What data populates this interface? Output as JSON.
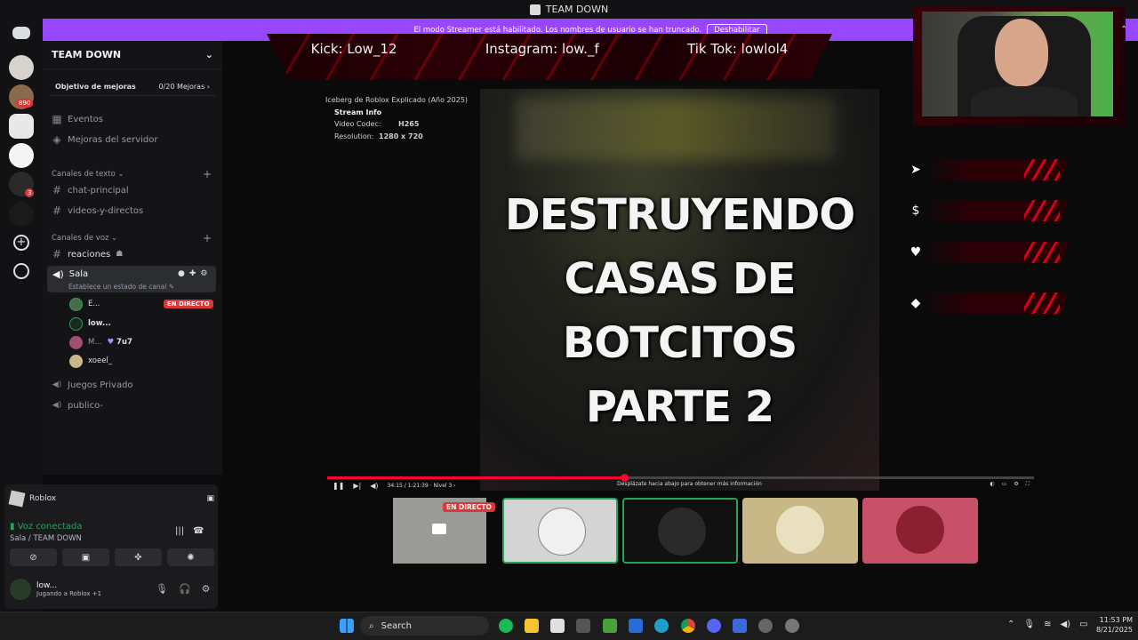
{
  "window": {
    "title": "TEAM DOWN"
  },
  "banner": {
    "text": "El modo Streamer está habilitado. Los nombres de usuario se han truncado.",
    "button": "Deshabilitar"
  },
  "rail": {
    "badges": [
      "890",
      "3"
    ]
  },
  "server": {
    "name": "TEAM DOWN",
    "boost": {
      "label": "Objetivo de mejoras",
      "progress": "0/20 Mejoras"
    },
    "events": "Eventos",
    "server_boosts": "Mejoras del servidor",
    "text_category": "Canales de texto",
    "text_channels": [
      "chat-principal",
      "videos-y-directos"
    ],
    "voice_category": "Canales de voz",
    "reactions_channel": "reaciones",
    "active_voice": {
      "name": "Sala",
      "status": "Establece un estado de canal"
    },
    "members": [
      {
        "name": "E...",
        "live": "EN DIRECTO"
      },
      {
        "name": "low..."
      },
      {
        "name": "M...",
        "tag": "7u7"
      },
      {
        "name": "xoeel_"
      }
    ],
    "other_voice": [
      "Juegos Privado",
      "publico-"
    ]
  },
  "user_panel": {
    "activity": "Roblox",
    "voice_connected": "Voz conectada",
    "voice_location": "Sala / TEAM DOWN",
    "username": "low...",
    "status": "Jugando a Roblox +1"
  },
  "stream": {
    "socials": [
      "Kick: Low_12",
      "Instagram: low._f",
      "Tik Tok: lowlol4"
    ],
    "video_title": "Iceberg de Roblox Explicado (Año 2025)",
    "info_title": "Stream Info",
    "codec_label": "Video Codec:",
    "codec_value": "H265",
    "res_label": "Resolution:",
    "res_value": "1280 x 720",
    "headline": [
      "DESTRUYENDO",
      "CASAS DE",
      "BOTCITOS",
      "PARTE 2"
    ],
    "time": "34:15 / 1:21:39 · Nivel 3 ›",
    "hint": "Desplázate hacia abajo para obtener más información",
    "progress": 0.42,
    "thumb_live": "EN DIRECTO"
  },
  "taskbar": {
    "search": "Search",
    "time": "11:53 PM",
    "date": "8/21/2025"
  },
  "colors": {
    "accent": "#9747ff",
    "live": "#da373c",
    "online": "#23a55a",
    "overlay_red": "#d40018"
  }
}
